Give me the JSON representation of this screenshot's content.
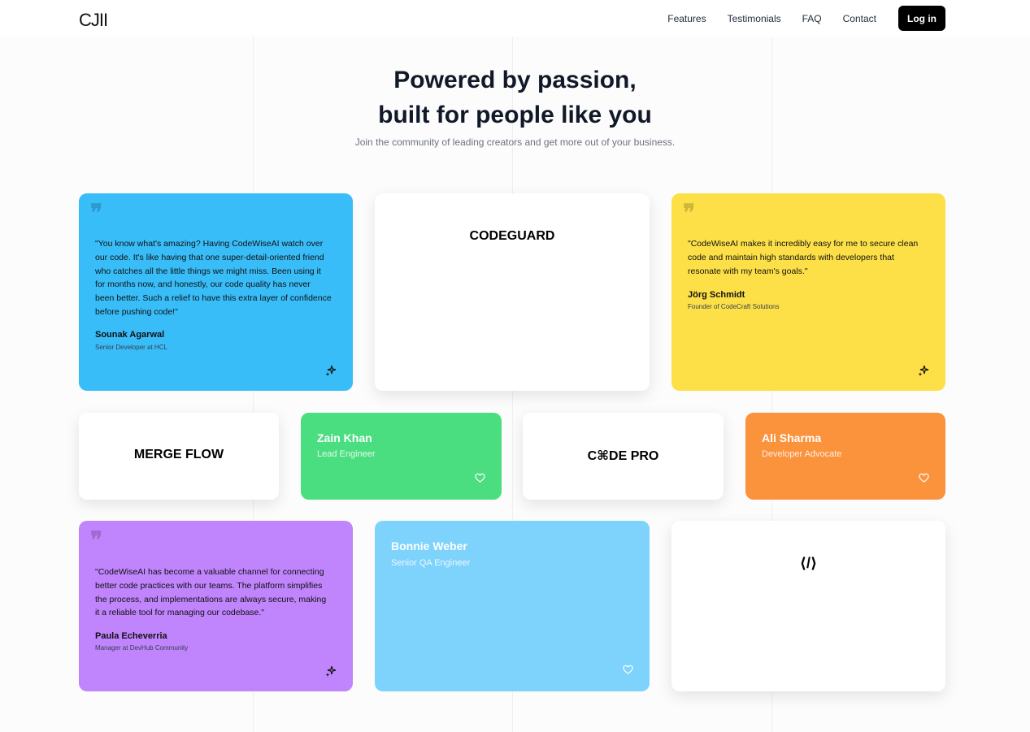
{
  "nav": {
    "logo": "CJII",
    "links": [
      "Features",
      "Testimonials",
      "FAQ",
      "Contact"
    ],
    "login": "Log in"
  },
  "hero": {
    "title_line1": "Powered by passion,",
    "title_line2": "built for people like you",
    "subtitle": "Join the community of leading creators and get more out of your business."
  },
  "cards": {
    "sounak": {
      "quote": "\"You know what's amazing? Having CodeWiseAI watch over our code. It's like having that one super-detail-oriented friend who catches all the little things we might miss. Been using it for months now, and honestly, our code quality has never been better. Such a relief to have this extra layer of confidence before pushing code!\"",
      "name": "Sounak Agarwal",
      "role": "Senior Developer at HCL",
      "color": "#38bdf8"
    },
    "codeguard": {
      "label": "CODEGUARD"
    },
    "jorg": {
      "quote": "\"CodeWiseAI makes it incredibly easy for me to secure clean code and maintain high standards with developers that resonate with my team's goals.\"",
      "name": "Jörg Schmidt",
      "role": "Founder of CodeCraft Solutions",
      "color": "#fde047"
    },
    "mergeflow": {
      "label": "MERGE FLOW"
    },
    "zain": {
      "name": "Zain Khan",
      "role": "Lead Engineer",
      "color": "#4ade80"
    },
    "codepro": {
      "label": "C⌘DE PRO"
    },
    "ali": {
      "name": "Ali Sharma",
      "role": "Developer Advocate",
      "color": "#fb923c"
    },
    "paula": {
      "quote": "\"CodeWiseAI has become a valuable channel for connecting better code practices with our teams. The platform simplifies the process, and implementations are always secure, making it a reliable tool for managing our codebase.\"",
      "name": "Paula Echeverria",
      "role": "Manager at DevHub Community",
      "color": "#c084fc"
    },
    "bonnie": {
      "name": "Bonnie Weber",
      "role": "Senior QA Engineer",
      "color": "#7dd3fc"
    },
    "code_icon": {
      "label": "⟨/⟩"
    }
  },
  "icons": {
    "quote": "quote-icon",
    "sparkle": "sparkle-icon",
    "heart": "heart-icon"
  }
}
